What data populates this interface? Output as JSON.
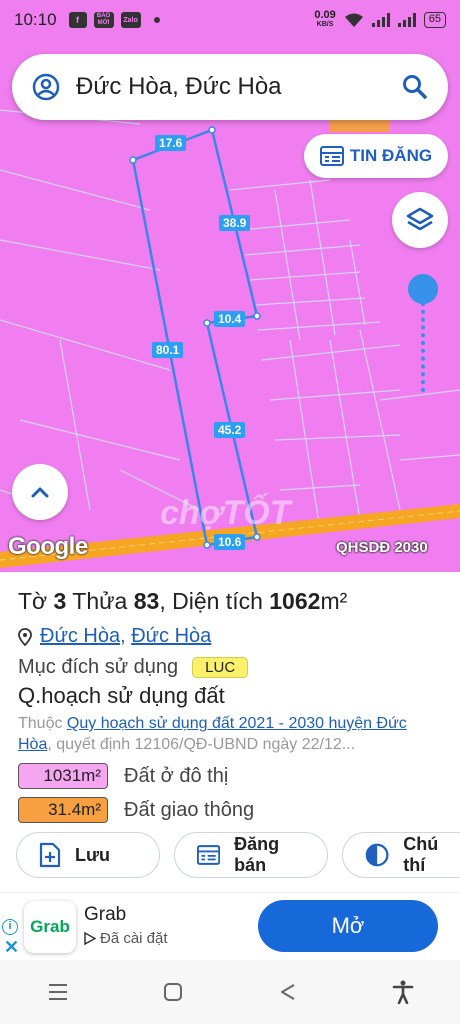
{
  "status_bar": {
    "time": "10:10",
    "notif_icons": [
      "facebook-icon",
      "baomoi-icon",
      "zalo-icon"
    ],
    "notif_labels": [
      "f",
      "BÁO MỚI",
      "Zalo"
    ],
    "speed_value": "0.09",
    "speed_unit": "KB/S",
    "battery": "65"
  },
  "search": {
    "location_text": "Đức Hòa, Đức Hòa"
  },
  "map": {
    "tin_dang_label": "TIN ĐĂNG",
    "segments": [
      "17.6",
      "38.9",
      "10.4",
      "80.1",
      "45.2",
      "10.6"
    ],
    "google_label": "Google",
    "plan_tag": "QHSDĐ 2030",
    "watermark": "chợTỐT",
    "land_color": "#f07ef0",
    "road_color": "#f6a623",
    "boundary_color": "#3a86e8"
  },
  "info": {
    "title_prefix": "Tờ ",
    "sheet_no": "3",
    "thua_label": " Thửa ",
    "thua_no": "83",
    "area_label": ", Diện tích ",
    "area_value": "1062",
    "area_unit": "m²",
    "loc_part1": "Đức Hòa",
    "loc_sep": ", ",
    "loc_part2": "Đức Hòa",
    "purpose_label": "Mục đích sử dụng",
    "purpose_code": "LUC",
    "qh_title": "Q.hoạch sử dụng đất",
    "qh_prefix": "Thuộc ",
    "qh_link": "Quy hoạch sử dụng đất 2021 - 2030 huyện Đức Hòa",
    "qh_suffix": ", quyết định 12106/QĐ-UBND ngày 22/12...",
    "areas": [
      {
        "value": "1031m²",
        "label": "Đất ở đô thị",
        "color": "#f5a6f0"
      },
      {
        "value": "31.4m²",
        "label": "Đất giao thông",
        "color": "#f6a041"
      }
    ]
  },
  "actions": [
    {
      "label": "Lưu",
      "icon": "add-file-icon"
    },
    {
      "label": "Đăng bán",
      "icon": "listing-icon"
    },
    {
      "label": "Chú thí",
      "icon": "half-circle-icon"
    }
  ],
  "ad": {
    "app_logo_text": "Grab",
    "app_name": "Grab",
    "installed_text": "Đã cài đặt",
    "open_label": "Mở"
  }
}
